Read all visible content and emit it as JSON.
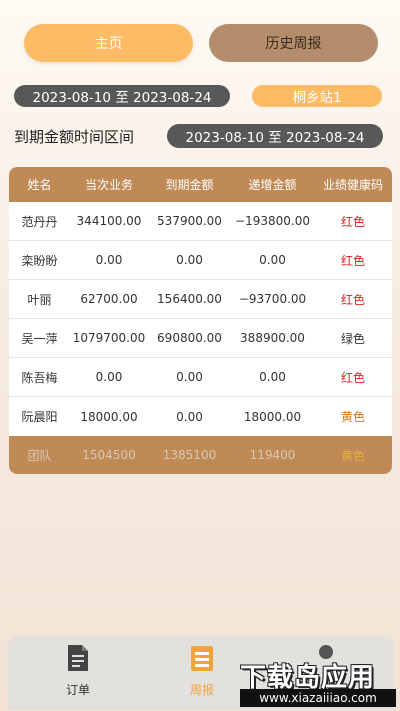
{
  "tabs": {
    "home": "主页",
    "history": "历史周报"
  },
  "date_range": "2023-08-10 至 2023-08-24",
  "station": "桐乡站1",
  "period": {
    "label": "到期金额时间区间",
    "value": "2023-08-10 至 2023-08-24"
  },
  "table": {
    "headers": [
      "姓名",
      "当次业务",
      "到期金额",
      "递增金额",
      "业绩健康码"
    ],
    "rows": [
      {
        "name": "范丹丹",
        "current": "344100.00",
        "due": "537900.00",
        "increase": "−193800.00",
        "health": "红色",
        "health_color": "#e02020"
      },
      {
        "name": "栾盼盼",
        "current": "0.00",
        "due": "0.00",
        "increase": "0.00",
        "health": "红色",
        "health_color": "#e02020"
      },
      {
        "name": "叶丽",
        "current": "62700.00",
        "due": "156400.00",
        "increase": "−93700.00",
        "health": "红色",
        "health_color": "#e02020"
      },
      {
        "name": "吴一萍",
        "current": "1079700.00",
        "due": "690800.00",
        "increase": "388900.00",
        "health": "绿色",
        "health_color": "#333333"
      },
      {
        "name": "陈吾梅",
        "current": "0.00",
        "due": "0.00",
        "increase": "0.00",
        "health": "红色",
        "health_color": "#e02020"
      },
      {
        "name": "阮晨阳",
        "current": "18000.00",
        "due": "0.00",
        "increase": "18000.00",
        "health": "黄色",
        "health_color": "#d17a10"
      }
    ],
    "team": {
      "name": "团队",
      "current": "1504500",
      "due": "1385100",
      "increase": "119400",
      "health": "黄色"
    }
  },
  "nav": {
    "orders": "订单",
    "weekly": "周报",
    "orders_icon": "document-icon",
    "weekly_icon": "report-icon",
    "me_icon": "user-icon"
  },
  "watermark": {
    "line1": "下载岛应用",
    "line2": "www.xiazaiiiao.com"
  },
  "colors": {
    "accent": "#fdbb66",
    "header": "#c08a57",
    "pill_dark": "#585858",
    "history_tab": "#b48e6c"
  }
}
